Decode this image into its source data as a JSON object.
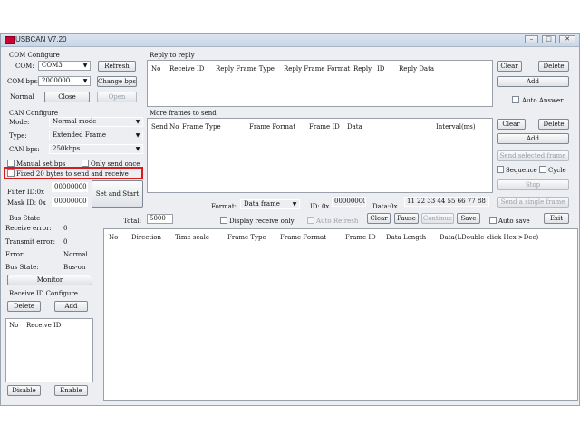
{
  "window": {
    "title": "USBCAN V7.20"
  },
  "com": {
    "section": "COM Configure",
    "com_label": "COM:",
    "com_value": "COM3",
    "bps_label": "COM bps:",
    "bps_value": "2000000",
    "refresh": "Refresh",
    "change_bps": "Change bps",
    "mode_value": "Normal",
    "close": "Close",
    "open": "Open"
  },
  "can": {
    "section": "CAN Configure",
    "mode_label": "Mode:",
    "mode_value": "Normal mode",
    "type_label": "Type:",
    "type_value": "Extended Frame",
    "bps_label": "CAN bps:",
    "bps_value": "250kbps",
    "manual_bps": "Manual set bps",
    "only_send_once": "Only send once",
    "fixed20": "Fixed 20 bytes to send and receive",
    "filter_label": "Filter ID:0x",
    "filter_value": "00000000",
    "mask_label": "Mask ID:  0x",
    "mask_value": "00000000",
    "set_start": "Set and Start"
  },
  "bus": {
    "section": "Bus State",
    "rx_err_label": "Receive error:",
    "rx_err": "0",
    "tx_err_label": "Transmit error:",
    "tx_err": "0",
    "error_label": "Error",
    "error_value": "Normal",
    "state_label": "Bus State:",
    "state_value": "Bus-on",
    "monitor": "Monitor"
  },
  "rxid": {
    "section": "Receive ID Configure",
    "delete": "Delete",
    "add": "Add",
    "col_no": "No",
    "col_rid": "Receive ID",
    "disable": "Disable",
    "enable": "Enable"
  },
  "reply": {
    "section": "Reply to reply",
    "columns": [
      "No",
      "Receive ID",
      "Reply Frame Type",
      "Reply Frame Format",
      "Reply",
      "ID",
      "Reply Data"
    ],
    "clear": "Clear",
    "delete": "Delete",
    "add": "Add",
    "auto_answer": "Auto Answer"
  },
  "more": {
    "section": "More frames to send",
    "columns": [
      "Send No",
      "Frame Type",
      "Frame Format",
      "Frame ID",
      "Data",
      "Interval(ms)"
    ],
    "clear": "Clear",
    "delete": "Delete",
    "add": "Add",
    "send_selected": "Send selected frame",
    "sequence": "Sequence",
    "cycle": "Cycle",
    "stop": "Stop",
    "send_single": "Send a single frame"
  },
  "send": {
    "format_label": "Format:",
    "format_value": "Data frame",
    "id_label": "ID: 0x",
    "id_value": "00000000",
    "data_label": "Data:0x",
    "data_value": "11 22 33 44 55 66 77 88"
  },
  "bottombar": {
    "total_label": "Total:",
    "total_value": "5000",
    "display_only": "Display receive only",
    "auto_refresh": "Auto Refresh",
    "clear": "Clear",
    "pause": "Pause",
    "continue": "Continue",
    "save": "Save",
    "auto_save": "Auto save",
    "exit": "Exit"
  },
  "log": {
    "columns": [
      "No",
      "Direction",
      "Time scale",
      "Frame Type",
      "Frame Format",
      "Frame ID",
      "Data Length",
      "Data(LDouble-click Hex->Dec)"
    ]
  },
  "colors": {
    "highlight": "#d81b1b"
  }
}
